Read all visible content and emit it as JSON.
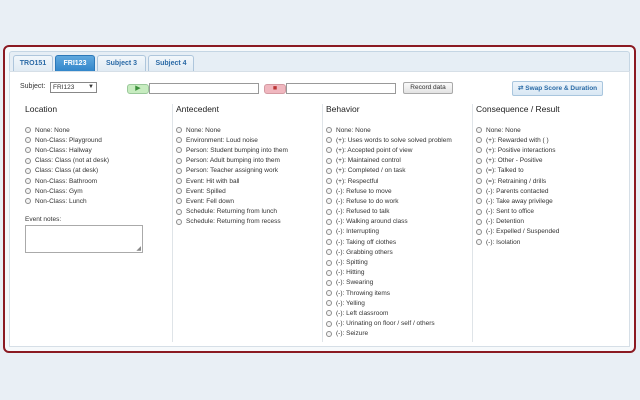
{
  "tabs": [
    {
      "label": "TRO151",
      "active": false
    },
    {
      "label": "FRI123",
      "active": true
    },
    {
      "label": "Subject 3",
      "active": false
    },
    {
      "label": "Subject 4",
      "active": false
    }
  ],
  "controls": {
    "subject_label": "Subject:",
    "subject_value": "FRI123",
    "play_icon": "play-icon",
    "stop_icon": "stop-icon",
    "record_label": "Record data",
    "swap_label": "Swap Score & Duration"
  },
  "columns": [
    {
      "title": "Location",
      "options": [
        "None: None",
        "Non-Class: Playground",
        "Non-Class: Hallway",
        "Class: Class (not at desk)",
        "Class: Class (at desk)",
        "Non-Class: Bathroom",
        "Non-Class: Gym",
        "Non-Class: Lunch"
      ]
    },
    {
      "title": "Antecedent",
      "options": [
        "None: None",
        "Environment: Loud noise",
        "Person: Student bumping into them",
        "Person: Adult bumping into them",
        "Person: Teacher assigning work",
        "Event: Hit with ball",
        "Event: Spilled",
        "Event: Fell down",
        "Schedule: Returning from lunch",
        "Schedule: Returning from recess"
      ]
    },
    {
      "title": "Behavior",
      "options": [
        "None: None",
        "(+): Uses words to solve solved problem",
        "(+): Accepted point of view",
        "(+): Maintained control",
        "(+): Completed / on task",
        "(+): Respectful",
        "(-): Refuse to move",
        "(-): Refuse to do work",
        "(-): Refused to talk",
        "(-): Walking around class",
        "(-): Interrupting",
        "(-): Taking off clothes",
        "(-): Grabbing others",
        "(-): Spitting",
        "(-): Hitting",
        "(-): Swearing",
        "(-): Throwing items",
        "(-): Yelling",
        "(-): Left classroom",
        "(-): Urinating on floor / self / others",
        "(-): Seizure"
      ]
    },
    {
      "title": "Consequence / Result",
      "options": [
        "None: None",
        "(+): Rewarded with ( )",
        "(+): Positive interactions",
        "(+): Other - Positive",
        "(=): Talked to",
        "(=): Retraining / drills",
        "(-): Parents contacted",
        "(-): Take away privilege",
        "(-): Sent to office",
        "(-): Detention",
        "(-): Expelled / Suspended",
        "(-): Isolation"
      ]
    }
  ],
  "event_notes_label": "Event notes:",
  "colors": {
    "frame_border": "#8b1a22",
    "active_tab": "#3a8fd1",
    "tab_text": "#2a6aa6"
  }
}
